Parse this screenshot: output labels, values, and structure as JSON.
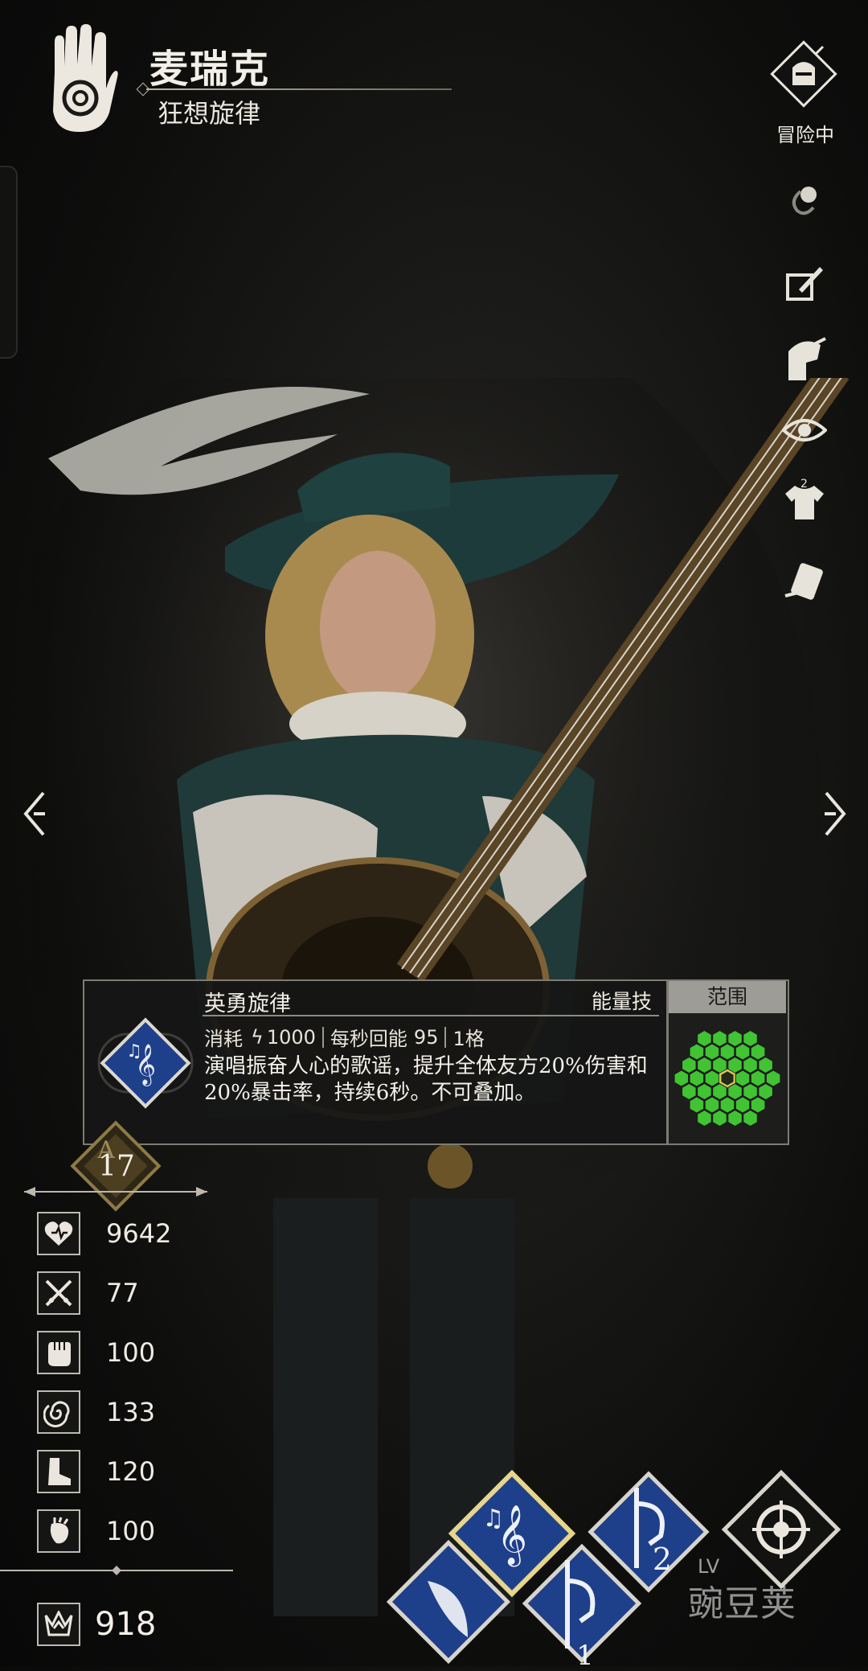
{
  "header": {
    "hero_name": "麦瑞克",
    "hero_title": "狂想旋律"
  },
  "status": {
    "adventure_label": "冒险中"
  },
  "side_actions": [
    "link-icon",
    "edit-icon",
    "helmet-icon",
    "eye-icon",
    "outfit-icon",
    "card-icon"
  ],
  "outfit_badge": "2",
  "skill": {
    "name": "英勇旋律",
    "type": "能量技",
    "cost_label": "消耗",
    "cost_value": "1000",
    "regen_label": "每秒回能",
    "regen_value": "95",
    "cells": "1格",
    "description": "演唱振奋人心的歌谣，提升全体友方20%伤害和20%暴击率，持续6秒。不可叠加。",
    "range_title": "范围"
  },
  "level": {
    "grade": "A",
    "value": "17"
  },
  "stats": [
    {
      "icon": "heart-icon",
      "value": "9642"
    },
    {
      "icon": "swords-icon",
      "value": "77"
    },
    {
      "icon": "fist-icon",
      "value": "100"
    },
    {
      "icon": "swirl-icon",
      "value": "133"
    },
    {
      "icon": "boot-icon",
      "value": "120"
    },
    {
      "icon": "anatomical-heart-icon",
      "value": "100"
    }
  ],
  "power": {
    "icon": "crown-icon",
    "value": "918"
  },
  "skill_bar": {
    "slot_labels": [
      "2",
      "1"
    ],
    "lv_text": "LV",
    "watermark": "豌豆荚"
  },
  "colors": {
    "card_bg": "#161615",
    "range_green": "#41c334",
    "skill_blue": "#1e3f8a",
    "gold": "#c5b47a"
  }
}
